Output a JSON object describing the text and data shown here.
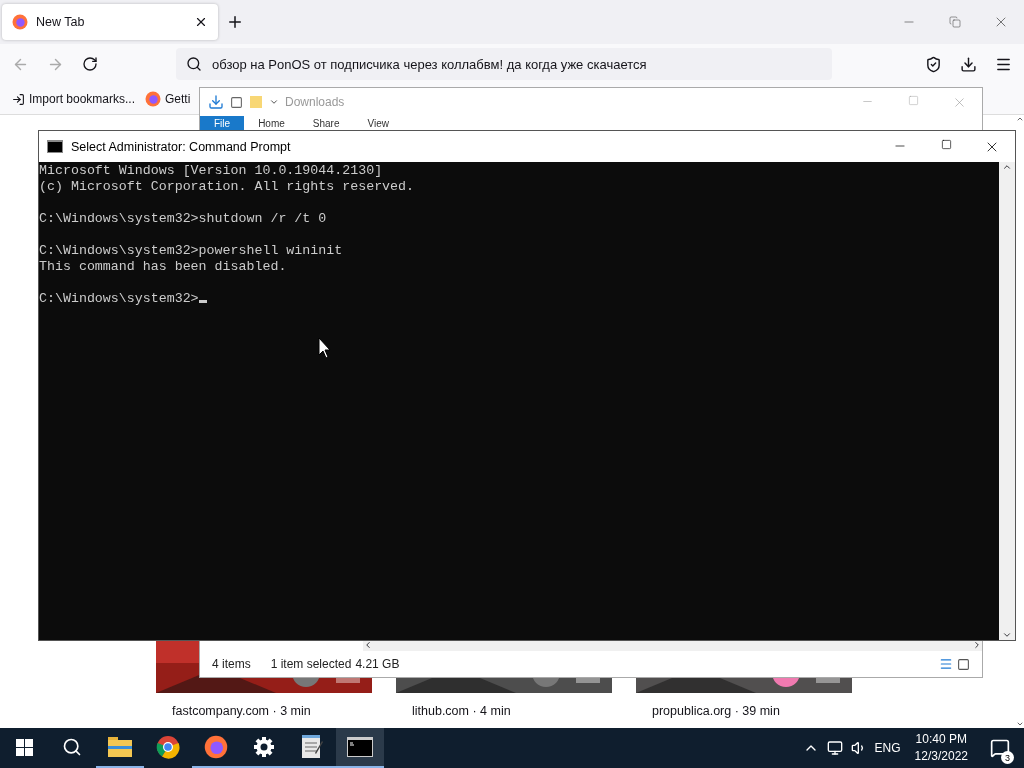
{
  "browser": {
    "tabs": [
      {
        "title": "New Tab",
        "selected": true
      }
    ],
    "address": {
      "value": "обзор на PonOS от подписчика через коллабвм! да когда уже скачается"
    },
    "bookmarks": [
      {
        "label": "Import bookmarks...",
        "kind": "import"
      },
      {
        "label": "Getti",
        "kind": "firefox"
      }
    ],
    "stories": [
      {
        "source": "fastcompany.com · 3 min"
      },
      {
        "source": "lithub.com · 4 min"
      },
      {
        "source": "propublica.org · 39 min"
      }
    ]
  },
  "explorer": {
    "title": "Downloads",
    "ribbon_tabs": [
      {
        "label": "File",
        "selected": true
      },
      {
        "label": "Home",
        "selected": false
      },
      {
        "label": "Share",
        "selected": false
      },
      {
        "label": "View",
        "selected": false
      }
    ],
    "status": {
      "items": "4 items",
      "selection": "1 item selected",
      "size": "4.21 GB"
    }
  },
  "cmd": {
    "title": "Select Administrator: Command Prompt",
    "blocks": [
      [
        "Microsoft Windows [Version 10.0.19044.2130]",
        "(c) Microsoft Corporation. All rights reserved."
      ],
      [
        "C:\\Windows\\system32>shutdown /r /t 0"
      ],
      [
        "C:\\Windows\\system32>powershell wininit",
        "This command has been disabled."
      ]
    ],
    "prompt": "C:\\Windows\\system32>"
  },
  "taskbar": {
    "apps": [
      {
        "kind": "start",
        "running": false,
        "active": false
      },
      {
        "kind": "search",
        "running": false,
        "active": false
      },
      {
        "kind": "folder",
        "running": true,
        "active": false
      },
      {
        "kind": "chrome",
        "running": false,
        "active": false
      },
      {
        "kind": "firefox",
        "running": true,
        "active": false
      },
      {
        "kind": "gear",
        "running": true,
        "active": false
      },
      {
        "kind": "notepad",
        "running": true,
        "active": false
      },
      {
        "kind": "terminal",
        "running": true,
        "active": true
      }
    ],
    "language": "ENG",
    "time": "10:40 PM",
    "date": "12/3/2022",
    "notifications": "3"
  }
}
